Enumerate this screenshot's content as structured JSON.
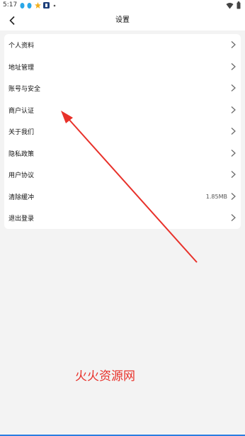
{
  "status_bar": {
    "time": "5:17",
    "icons": [
      "notification-a-icon",
      "notification-b-icon",
      "star-icon",
      "app-icon",
      "dot-icon",
      "wifi-icon",
      "battery-icon"
    ]
  },
  "header": {
    "title": "设置",
    "back_icon": "back-arrow-icon"
  },
  "menu": {
    "items": [
      {
        "label": "个人资料",
        "value": ""
      },
      {
        "label": "地址管理",
        "value": ""
      },
      {
        "label": "账号与安全",
        "value": ""
      },
      {
        "label": "商户认证",
        "value": ""
      },
      {
        "label": "关于我们",
        "value": ""
      },
      {
        "label": "隐私政策",
        "value": ""
      },
      {
        "label": "用户协议",
        "value": ""
      },
      {
        "label": "清除缓冲",
        "value": "1.85MB"
      },
      {
        "label": "退出登录",
        "value": ""
      }
    ]
  },
  "watermark": {
    "text": "火火资源网",
    "color": "#e8312a"
  },
  "colors": {
    "background": "#f3f3f3",
    "card": "#ffffff",
    "annotation_arrow": "#e8312a"
  }
}
